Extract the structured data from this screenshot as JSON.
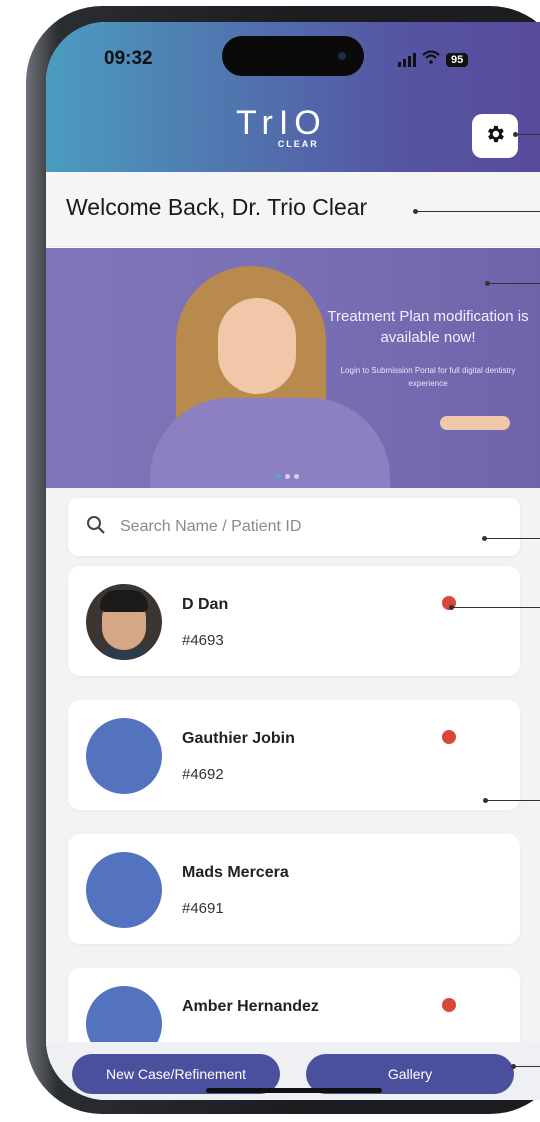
{
  "status_bar": {
    "time": "09:32",
    "battery": "95"
  },
  "header": {
    "logo_text": "TrIO",
    "logo_sub": "CLEAR"
  },
  "welcome": {
    "text": "Welcome Back, Dr. Trio Clear"
  },
  "banner": {
    "title": "Treatment Plan modification is available now!",
    "subtitle": "Login to Submission Portal for full digital dentistry experience",
    "active_slide": 0,
    "slide_count": 3
  },
  "search": {
    "placeholder": "Search Name / Patient ID"
  },
  "patients": [
    {
      "name": "D Dan",
      "id": "#4693",
      "avatar": "photo",
      "status_dot": true
    },
    {
      "name": "Gauthier Jobin",
      "id": "#4692",
      "avatar": "placeholder",
      "status_dot": true
    },
    {
      "name": "Mads Mercera",
      "id": "#4691",
      "avatar": "placeholder",
      "status_dot": false
    },
    {
      "name": "Amber Hernandez",
      "id": "",
      "avatar": "placeholder",
      "status_dot": true
    }
  ],
  "bottom_buttons": {
    "new_case": "New Case/Refinement",
    "gallery": "Gallery"
  },
  "icons": [
    "gear-icon",
    "search-icon",
    "wifi-icon",
    "signal-icon",
    "battery-icon"
  ],
  "colors": {
    "accent": "#4a4f9e",
    "status_dot": "#d9473b",
    "avatar_placeholder": "#5473bf"
  }
}
